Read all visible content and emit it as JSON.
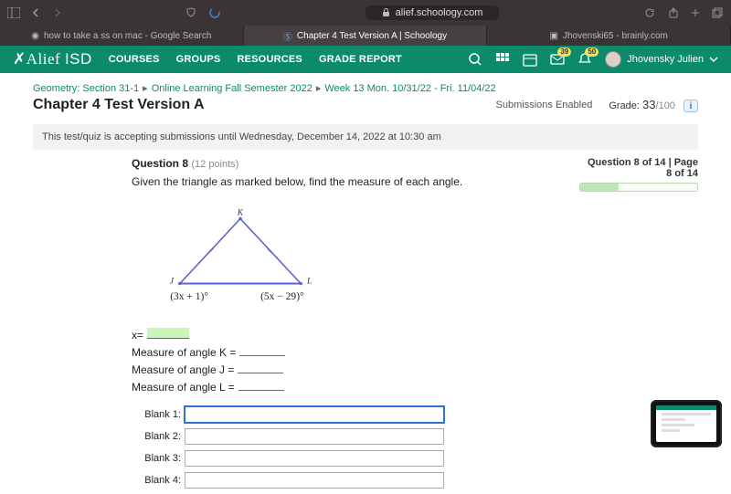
{
  "browser": {
    "url_host": "alief.schoology.com",
    "tabs": [
      {
        "label": "how to take a ss on mac - Google Search"
      },
      {
        "label": "Chapter 4 Test Version A | Schoology"
      },
      {
        "label": "Jhovenski65 - brainly.com"
      }
    ]
  },
  "header": {
    "logo_a": "Alief",
    "logo_b": "ISD",
    "nav": [
      "COURSES",
      "GROUPS",
      "RESOURCES",
      "GRADE REPORT"
    ],
    "mail_badge": "39",
    "bell_badge": "50",
    "user_name": "Jhovensky Julien"
  },
  "breadcrumbs": [
    "Geometry: Section 31-1",
    "Online Learning Fall Semester 2022",
    "Week 13 Mon. 10/31/22 - Fri. 11/04/22"
  ],
  "page_title": "Chapter 4 Test Version A",
  "submissions_label": "Submissions Enabled",
  "grade": {
    "label": "Grade:",
    "earned": "33",
    "total": "/100"
  },
  "notice": "This test/quiz is accepting submissions until Wednesday, December 14, 2022 at 10:30 am",
  "question_location": "Question 8 of 14 | Page 8 of 14",
  "question": {
    "number": "Question 8",
    "points": "(12 points)",
    "prompt": "Given the triangle as marked below, find the measure of each angle.",
    "figure": {
      "top_label": "K",
      "left_label": "J",
      "right_label": "L",
      "left_expr": "(3x  +  1)°",
      "right_expr": "(5x  −  29)°"
    },
    "answers": {
      "x_label": "x=",
      "k_label": "Measure of angle K =",
      "j_label": "Measure of angle J =",
      "l_label": "Measure of angle L ="
    },
    "blanks": [
      "Blank 1:",
      "Blank 2:",
      "Blank 3:",
      "Blank 4:"
    ]
  }
}
